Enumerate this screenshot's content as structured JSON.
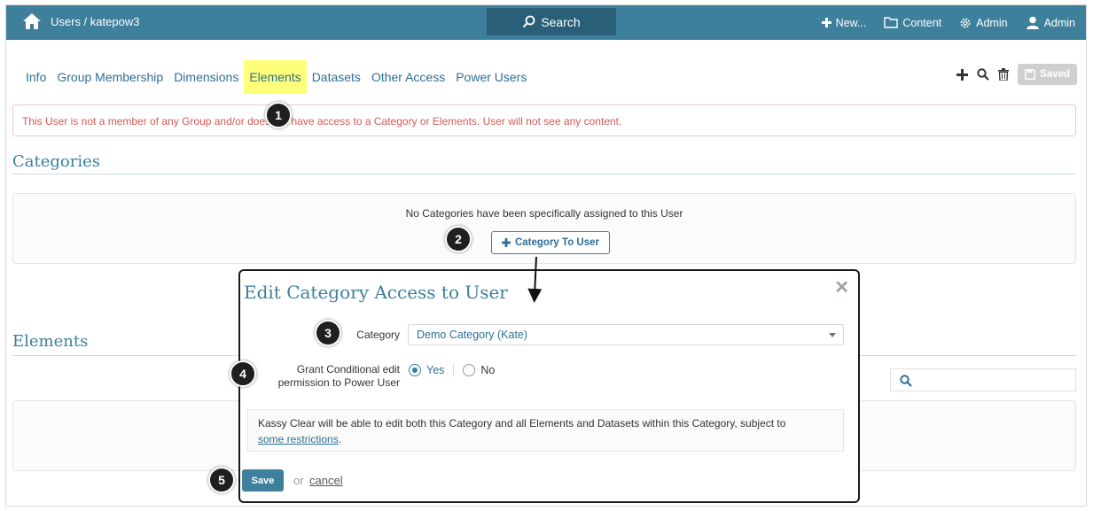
{
  "topbar": {
    "breadcrumb": "Users / katepow3",
    "search_label": "Search",
    "new_label": "New...",
    "content_label": "Content",
    "admin_menu_label": "Admin",
    "user_label": "Admin",
    "bar_color": "#3e7f9c"
  },
  "tabs": [
    {
      "label": "Info"
    },
    {
      "label": "Group Membership"
    },
    {
      "label": "Dimensions"
    },
    {
      "label": "Elements",
      "active": true
    },
    {
      "label": "Datasets"
    },
    {
      "label": "Other Access"
    },
    {
      "label": "Power Users"
    }
  ],
  "toolbar": {
    "saved_label": "Saved"
  },
  "alert": {
    "text": "This User is not a member of any Group and/or does not have access to a Category or Elements. User will not see any content."
  },
  "categories": {
    "title": "Categories",
    "empty_text": "No Categories have been specifically assigned to this User",
    "add_button": "Category To User"
  },
  "elements": {
    "title": "Elements"
  },
  "modal": {
    "title": "Edit Category Access to User",
    "category_label": "Category",
    "category_value": "Demo Category (Kate)",
    "grant_label_1": "Grant Conditional edit",
    "grant_label_2": "permission to Power User",
    "yes_label": "Yes",
    "no_label": "No",
    "info_text": "Kassy Clear will be able to edit both this Category and all Elements and Datasets within this Category, subject to",
    "info_link": "some restrictions",
    "info_end": ".",
    "save_label": "Save",
    "or_text": "or",
    "cancel_label": "cancel"
  },
  "callouts": [
    "1",
    "2",
    "3",
    "4",
    "5"
  ],
  "colors": {
    "accent": "#3e7f9c",
    "alert_text": "#d05a57",
    "highlight": "#ffff7a"
  }
}
